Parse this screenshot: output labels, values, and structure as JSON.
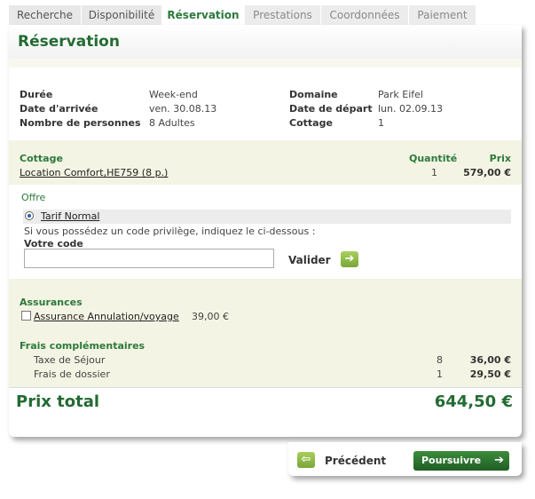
{
  "tabs": [
    {
      "label": "Recherche",
      "state": "normal"
    },
    {
      "label": "Disponibilité",
      "state": "normal"
    },
    {
      "label": "Réservation",
      "state": "active"
    },
    {
      "label": "Prestations",
      "state": "disabled"
    },
    {
      "label": "Coordonnées",
      "state": "disabled"
    },
    {
      "label": "Paiement",
      "state": "disabled"
    }
  ],
  "title": "Réservation",
  "summary": {
    "duree_label": "Durée",
    "duree_value": "Week-end",
    "arrivee_label": "Date d'arrivée",
    "arrivee_value": "ven. 30.08.13",
    "personnes_label": "Nombre de personnes",
    "personnes_value": "8 Adultes",
    "domaine_label": "Domaine",
    "domaine_value": "Park Eifel",
    "depart_label": "Date de départ",
    "depart_value": "lun. 02.09.13",
    "cottage_label": "Cottage",
    "cottage_value": "1"
  },
  "cottage": {
    "heading": "Cottage",
    "qty_header": "Quantité",
    "price_header": "Prix",
    "item": "Location Comfort,HE759 (8 p.)",
    "qty": "1",
    "price": "579,00 €"
  },
  "offre": {
    "heading": "Offre",
    "option": "Tarif Normal",
    "hint": "Si vous possédez un code privilège, indiquez le ci-dessous :",
    "code_label": "Votre code",
    "code_value": "",
    "validate": "Valider"
  },
  "assurances": {
    "heading": "Assurances",
    "item": "Assurance Annulation/voyage",
    "price": "39,00 €"
  },
  "frais": {
    "heading": "Frais complémentaires",
    "rows": [
      {
        "label": "Taxe de Séjour",
        "qty": "8",
        "price": "36,00 €"
      },
      {
        "label": "Frais de dossier",
        "qty": "1",
        "price": "29,50 €"
      }
    ]
  },
  "total": {
    "label": "Prix total",
    "value": "644,50 €"
  },
  "nav": {
    "previous": "Précédent",
    "next": "Poursuivre"
  },
  "colors": {
    "accent": "#2b7a3b",
    "beige": "#f4f4e4",
    "button_green": "#7aa63a"
  }
}
